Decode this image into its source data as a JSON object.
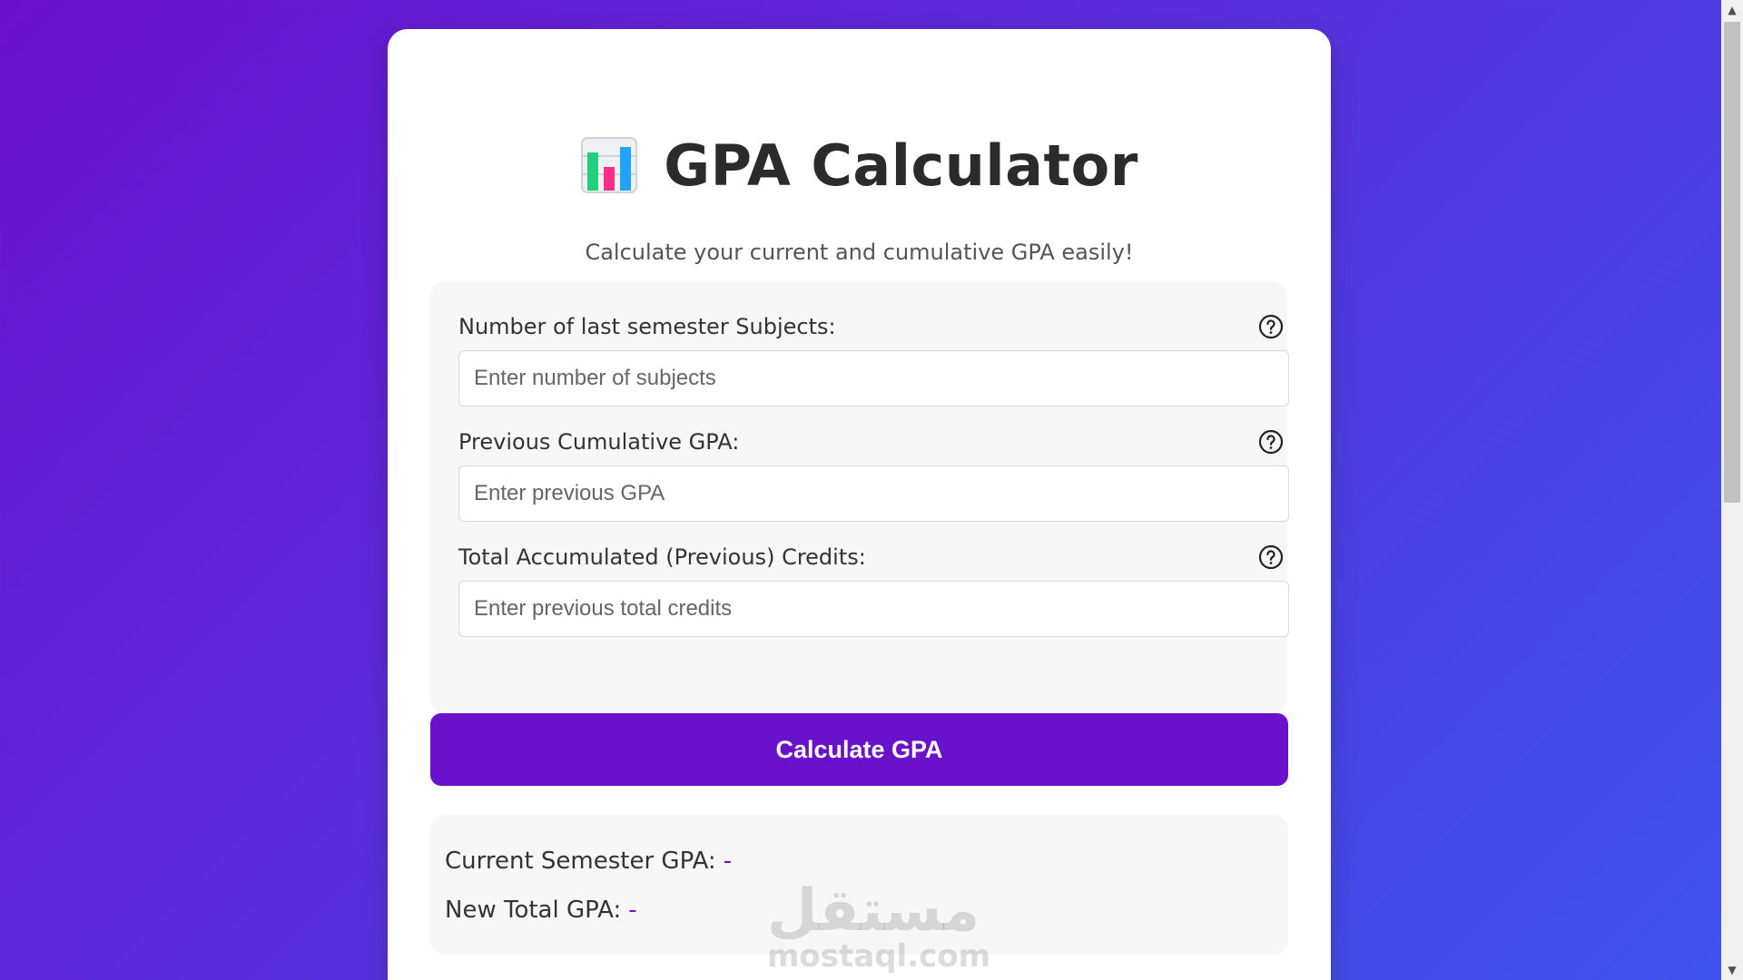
{
  "header": {
    "title": "GPA Calculator",
    "subtitle": "Calculate your current and cumulative GPA easily!",
    "icon": "bar-chart-icon"
  },
  "form": {
    "fields": [
      {
        "label": "Number of last semester Subjects:",
        "placeholder": "Enter number of subjects",
        "value": ""
      },
      {
        "label": "Previous Cumulative GPA:",
        "placeholder": "Enter previous GPA",
        "value": ""
      },
      {
        "label": "Total Accumulated (Previous) Credits:",
        "placeholder": "Enter previous total credits",
        "value": ""
      }
    ],
    "help_icon": "question-circle-icon"
  },
  "actions": {
    "calculate_label": "Calculate GPA"
  },
  "results": {
    "current_label": "Current Semester GPA:",
    "current_value": "-",
    "total_label": "New Total GPA:",
    "total_value": "-"
  },
  "watermark": {
    "arabic": "مستقل",
    "latin": "mostaql.com"
  },
  "colors": {
    "accent": "#6a11cb",
    "gradient_start": "#6a11cb",
    "gradient_end": "#3e55ec"
  }
}
